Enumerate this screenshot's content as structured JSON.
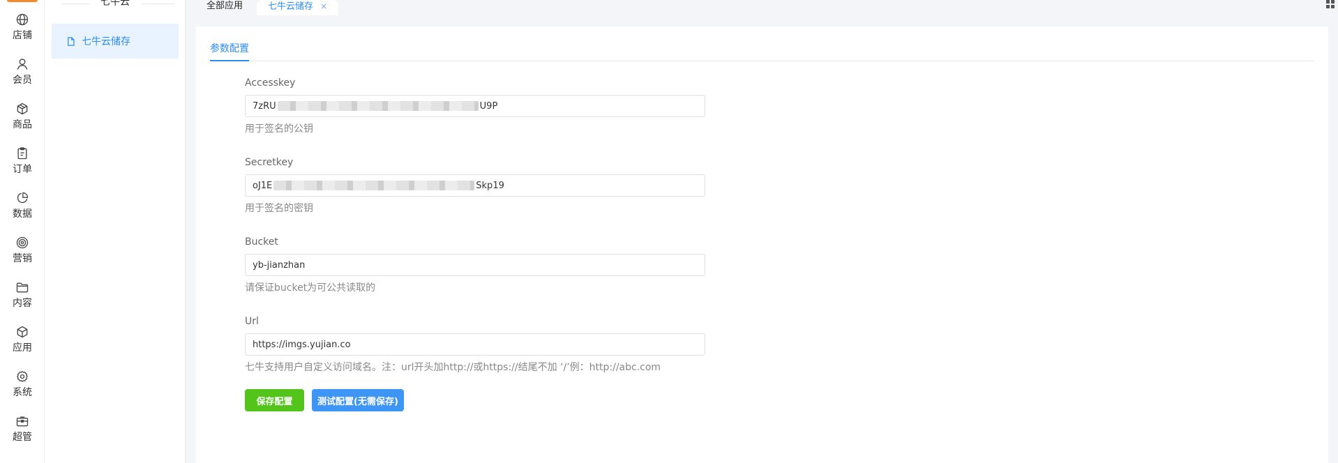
{
  "nav": {
    "items": [
      {
        "label": "店铺",
        "icon": "globe-icon"
      },
      {
        "label": "会员",
        "icon": "user-icon"
      },
      {
        "label": "商品",
        "icon": "box-icon"
      },
      {
        "label": "订单",
        "icon": "clipboard-icon"
      },
      {
        "label": "数据",
        "icon": "pie-chart-icon"
      },
      {
        "label": "营销",
        "icon": "target-icon"
      },
      {
        "label": "内容",
        "icon": "folder-icon"
      },
      {
        "label": "应用",
        "icon": "cube-icon"
      },
      {
        "label": "系统",
        "icon": "gear-icon"
      },
      {
        "label": "超管",
        "icon": "briefcase-icon"
      }
    ]
  },
  "subnav": {
    "title": "七牛云",
    "item": {
      "label": "七牛云储存",
      "icon": "file-icon"
    }
  },
  "tabs": {
    "all_label": "全部应用",
    "active_label": "七牛云储存",
    "close_glyph": "×"
  },
  "section": {
    "tab_label": "参数配置"
  },
  "form": {
    "accesskey": {
      "label": "Accesskey",
      "value_start": "7zRU",
      "value_end": "U9P",
      "help": "用于签名的公钥"
    },
    "secretkey": {
      "label": "Secretkey",
      "value_start": "oJ1E",
      "value_end": "Skp19",
      "help": "用于签名的密钥"
    },
    "bucket": {
      "label": "Bucket",
      "value": "yb-jianzhan",
      "help": "请保证bucket为可公共读取的"
    },
    "url": {
      "label": "Url",
      "value": "https://imgs.yujian.co",
      "help": "七牛支持用户自定义访问域名。注：url开头加http://或https://结尾不加 ‘/’例：http://abc.com"
    }
  },
  "buttons": {
    "save_label": "保存配置",
    "test_label": "测试配置(无需保存)"
  },
  "colors": {
    "accent": "#2d8cf0",
    "save": "#52c41a",
    "test": "#3d95f6"
  }
}
